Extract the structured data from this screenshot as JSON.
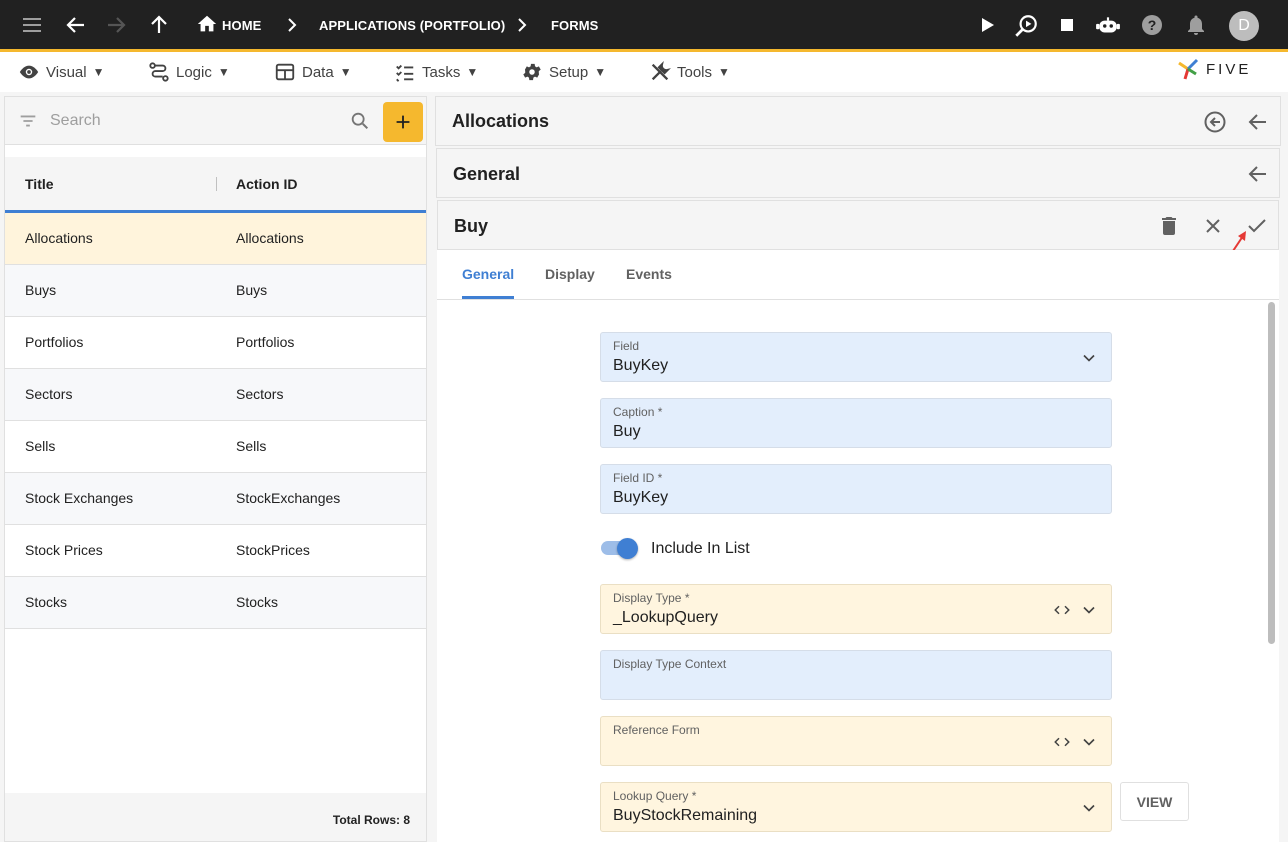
{
  "topbar": {
    "breadcrumbs": [
      "HOME",
      "APPLICATIONS (PORTFOLIO)",
      "FORMS"
    ],
    "avatar_initial": "D",
    "icons": [
      "menu-icon",
      "back-arrow-icon",
      "forward-arrow-icon",
      "up-arrow-icon",
      "home-icon",
      "play-icon",
      "debug-search-icon",
      "stop-icon",
      "chatbot-icon",
      "help-icon",
      "bell-icon"
    ]
  },
  "menubar": {
    "items": [
      {
        "label": "Visual",
        "icon": "eye-icon"
      },
      {
        "label": "Logic",
        "icon": "logic-icon"
      },
      {
        "label": "Data",
        "icon": "table-icon"
      },
      {
        "label": "Tasks",
        "icon": "checklist-icon"
      },
      {
        "label": "Setup",
        "icon": "gear-icon"
      },
      {
        "label": "Tools",
        "icon": "tools-icon"
      }
    ],
    "dropdown_marker": "▼",
    "logo_text": "FIVE"
  },
  "list": {
    "search_placeholder": "Search",
    "columns": [
      "Title",
      "Action ID"
    ],
    "rows": [
      {
        "title": "Allocations",
        "action_id": "Allocations"
      },
      {
        "title": "Buys",
        "action_id": "Buys"
      },
      {
        "title": "Portfolios",
        "action_id": "Portfolios"
      },
      {
        "title": "Sectors",
        "action_id": "Sectors"
      },
      {
        "title": "Sells",
        "action_id": "Sells"
      },
      {
        "title": "Stock Exchanges",
        "action_id": "StockExchanges"
      },
      {
        "title": "Stock Prices",
        "action_id": "StockPrices"
      },
      {
        "title": "Stocks",
        "action_id": "Stocks"
      }
    ],
    "selected_index": 0,
    "footer": "Total Rows: 8"
  },
  "panels": {
    "allocations_title": "Allocations",
    "general_title": "General",
    "record_title": "Buy"
  },
  "tabs": [
    "General",
    "Display",
    "Events"
  ],
  "active_tab": "General",
  "form": {
    "field": {
      "label": "Field",
      "value": "BuyKey"
    },
    "caption": {
      "label": "Caption *",
      "value": "Buy"
    },
    "field_id": {
      "label": "Field ID *",
      "value": "BuyKey"
    },
    "include_in_list": {
      "label": "Include In List",
      "checked": true
    },
    "display_type": {
      "label": "Display Type *",
      "value": "_LookupQuery"
    },
    "display_type_context": {
      "label": "Display Type Context",
      "value": ""
    },
    "reference_form": {
      "label": "Reference Form",
      "value": ""
    },
    "lookup_query": {
      "label": "Lookup Query *",
      "value": "BuyStockRemaining"
    },
    "view_button": "VIEW"
  },
  "colors": {
    "accent": "#3f7fd3",
    "brand_yellow": "#f5b82e",
    "topbar": "#212121",
    "annotation_arrow": "#e53935"
  }
}
